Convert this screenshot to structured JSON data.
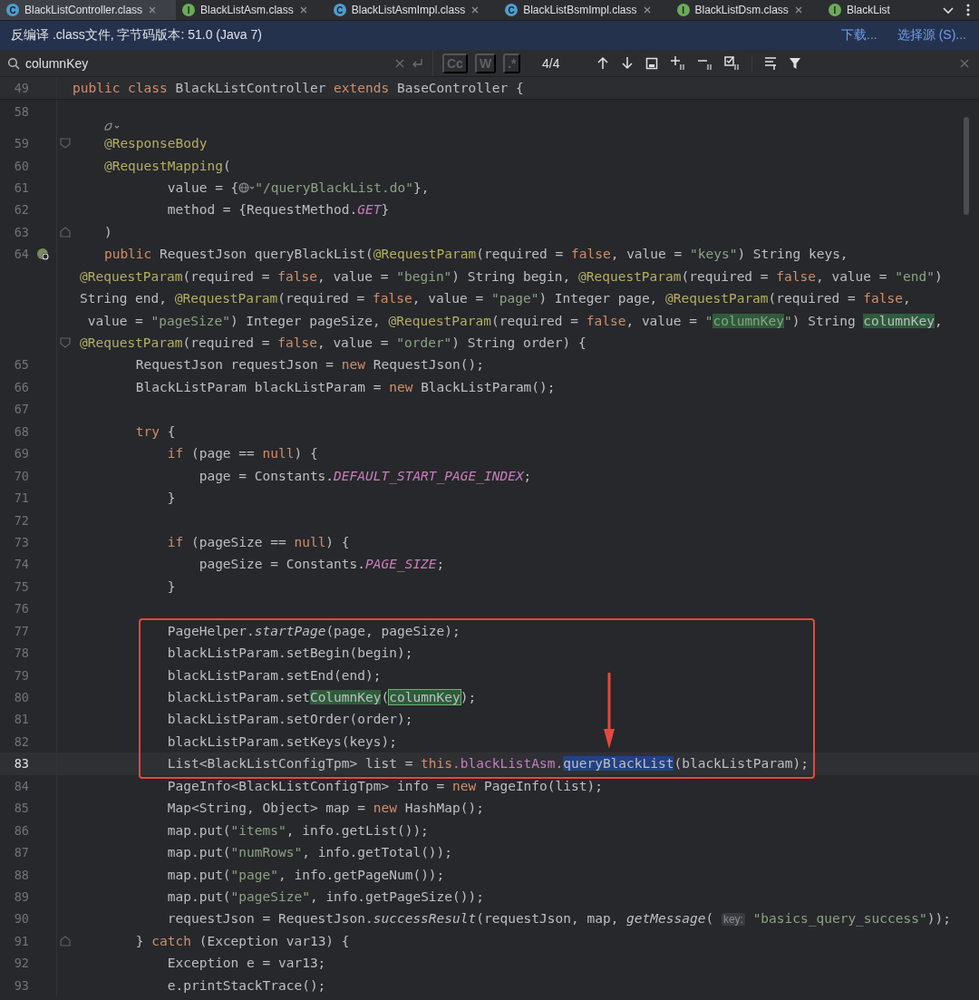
{
  "tabs": [
    {
      "label": "BlackListController.class",
      "icon_letter": "C",
      "color": "#4e9ecf",
      "selected": true
    },
    {
      "label": "BlackListAsm.class",
      "icon_letter": "I",
      "color": "#6bab58",
      "selected": false
    },
    {
      "label": "BlackListAsmImpl.class",
      "icon_letter": "C",
      "color": "#4e9ecf",
      "selected": false
    },
    {
      "label": "BlackListBsmImpl.class",
      "icon_letter": "C",
      "color": "#4e9ecf",
      "selected": false
    },
    {
      "label": "BlackListDsm.class",
      "icon_letter": "I",
      "color": "#6bab58",
      "selected": false
    },
    {
      "label": "BlackList",
      "icon_letter": "I",
      "color": "#6bab58",
      "selected": false
    }
  ],
  "info_bar": {
    "message": "反编译 .class文件, 字节码版本: 51.0 (Java 7)",
    "links": [
      "下载...",
      "选择源 (S)..."
    ]
  },
  "search": {
    "value": "columnKey",
    "options": [
      {
        "label": "Cc",
        "selected": false
      },
      {
        "label": "W",
        "selected": false
      },
      {
        "label": ".*",
        "selected": false
      }
    ],
    "match_count": "4/4"
  },
  "editor": {
    "lines": [
      {
        "number": "49",
        "sticky": true,
        "tokens": [
          {
            "text": "public",
            "kind": "keyword"
          },
          {
            "text": " class",
            "kind": "keyword"
          },
          {
            "text": " BlackListController ",
            "kind": "plain"
          },
          {
            "text": "extends",
            "kind": "keyword"
          },
          {
            "text": " BaseController {",
            "kind": "plain"
          }
        ]
      },
      {
        "number": "58"
      },
      {
        "kind": "inlay"
      },
      {
        "number": "59",
        "fold_start": true,
        "tokens": [
          {
            "text": "    @ResponseBody",
            "kind": "annotation"
          }
        ]
      },
      {
        "number": "60",
        "tokens": [
          {
            "text": "    @RequestMapping",
            "kind": "annotation"
          },
          {
            "text": "(",
            "kind": "plain"
          }
        ]
      },
      {
        "number": "61",
        "tokens": [
          {
            "text": "            value = {",
            "kind": "plain"
          },
          {
            "kind": "globe"
          },
          {
            "text": "\"/queryBlackList.do\"",
            "kind": "string"
          },
          {
            "text": "},",
            "kind": "plain"
          }
        ]
      },
      {
        "number": "62",
        "tokens": [
          {
            "text": "            method = {RequestMethod.",
            "kind": "plain"
          },
          {
            "text": "GET",
            "kind": "constant"
          },
          {
            "text": "}",
            "kind": "plain"
          }
        ]
      },
      {
        "number": "63",
        "fold_end": true,
        "tokens": [
          {
            "text": "    )",
            "kind": "plain"
          }
        ]
      },
      {
        "number": "64",
        "endpoint": true,
        "tokens": [
          {
            "text": "    public",
            "kind": "keyword"
          },
          {
            "text": " RequestJson queryBlackList(",
            "kind": "plain"
          },
          {
            "text": "@RequestParam",
            "kind": "annotation"
          },
          {
            "text": "(required = ",
            "kind": "plain"
          },
          {
            "text": "false",
            "kind": "keyword"
          },
          {
            "text": ", value = ",
            "kind": "plain"
          },
          {
            "text": "\"keys\"",
            "kind": "string"
          },
          {
            "text": ") String keys,",
            "kind": "plain"
          }
        ]
      },
      {
        "wrapped": true,
        "tokens": [
          {
            "text": "@RequestParam",
            "kind": "annotation"
          },
          {
            "text": "(required = ",
            "kind": "plain"
          },
          {
            "text": "false",
            "kind": "keyword"
          },
          {
            "text": ", value = ",
            "kind": "plain"
          },
          {
            "text": "\"begin\"",
            "kind": "string"
          },
          {
            "text": ") String begin, ",
            "kind": "plain"
          },
          {
            "text": "@RequestParam",
            "kind": "annotation"
          },
          {
            "text": "(required = ",
            "kind": "plain"
          },
          {
            "text": "false",
            "kind": "keyword"
          },
          {
            "text": ", value = ",
            "kind": "plain"
          },
          {
            "text": "\"end\"",
            "kind": "string"
          },
          {
            "text": ")",
            "kind": "plain"
          }
        ]
      },
      {
        "wrapped": true,
        "tokens": [
          {
            "text": "String end, ",
            "kind": "plain"
          },
          {
            "text": "@RequestParam",
            "kind": "annotation"
          },
          {
            "text": "(required = ",
            "kind": "plain"
          },
          {
            "text": "false",
            "kind": "keyword"
          },
          {
            "text": ", value = ",
            "kind": "plain"
          },
          {
            "text": "\"page\"",
            "kind": "string"
          },
          {
            "text": ") Integer page, ",
            "kind": "plain"
          },
          {
            "text": "@RequestParam",
            "kind": "annotation"
          },
          {
            "text": "(required = ",
            "kind": "plain"
          },
          {
            "text": "false",
            "kind": "keyword"
          },
          {
            "text": ",",
            "kind": "plain"
          }
        ]
      },
      {
        "wrapped": true,
        "tokens": [
          {
            "text": " value = ",
            "kind": "plain"
          },
          {
            "text": "\"pageSize\"",
            "kind": "string"
          },
          {
            "text": ") Integer pageSize, ",
            "kind": "plain"
          },
          {
            "text": "@RequestParam",
            "kind": "annotation"
          },
          {
            "text": "(required = ",
            "kind": "plain"
          },
          {
            "text": "false",
            "kind": "keyword"
          },
          {
            "text": ", value = ",
            "kind": "plain"
          },
          {
            "text": "\"",
            "kind": "string"
          },
          {
            "text": "columnKey",
            "kind": "string-match"
          },
          {
            "text": "\"",
            "kind": "string"
          },
          {
            "text": ") String ",
            "kind": "plain"
          },
          {
            "text": "columnKey",
            "kind": "match"
          },
          {
            "text": ",",
            "kind": "plain"
          }
        ]
      },
      {
        "wrapped": true,
        "fold_start": true,
        "tokens": [
          {
            "text": "@RequestParam",
            "kind": "annotation"
          },
          {
            "text": "(required = ",
            "kind": "plain"
          },
          {
            "text": "false",
            "kind": "keyword"
          },
          {
            "text": ", value = ",
            "kind": "plain"
          },
          {
            "text": "\"order\"",
            "kind": "string"
          },
          {
            "text": ") String order) {",
            "kind": "plain"
          }
        ]
      },
      {
        "number": "65",
        "tokens": [
          {
            "text": "        RequestJson requestJson = ",
            "kind": "plain"
          },
          {
            "text": "new",
            "kind": "keyword"
          },
          {
            "text": " RequestJson();",
            "kind": "plain"
          }
        ]
      },
      {
        "number": "66",
        "tokens": [
          {
            "text": "        BlackListParam blackListParam = ",
            "kind": "plain"
          },
          {
            "text": "new",
            "kind": "keyword"
          },
          {
            "text": " BlackListParam();",
            "kind": "plain"
          }
        ]
      },
      {
        "number": "67"
      },
      {
        "number": "68",
        "tokens": [
          {
            "text": "        try",
            "kind": "keyword"
          },
          {
            "text": " {",
            "kind": "plain"
          }
        ]
      },
      {
        "number": "69",
        "tokens": [
          {
            "text": "            if",
            "kind": "keyword"
          },
          {
            "text": " (page == ",
            "kind": "plain"
          },
          {
            "text": "null",
            "kind": "keyword"
          },
          {
            "text": ") {",
            "kind": "plain"
          }
        ]
      },
      {
        "number": "70",
        "tokens": [
          {
            "text": "                page = Constants.",
            "kind": "plain"
          },
          {
            "text": "DEFAULT_START_PAGE_INDEX",
            "kind": "constant"
          },
          {
            "text": ";",
            "kind": "plain"
          }
        ]
      },
      {
        "number": "71",
        "tokens": [
          {
            "text": "            }",
            "kind": "plain"
          }
        ]
      },
      {
        "number": "72"
      },
      {
        "number": "73",
        "tokens": [
          {
            "text": "            if",
            "kind": "keyword"
          },
          {
            "text": " (pageSize == ",
            "kind": "plain"
          },
          {
            "text": "null",
            "kind": "keyword"
          },
          {
            "text": ") {",
            "kind": "plain"
          }
        ]
      },
      {
        "number": "74",
        "tokens": [
          {
            "text": "                pageSize = Constants.",
            "kind": "plain"
          },
          {
            "text": "PAGE_SIZE",
            "kind": "constant"
          },
          {
            "text": ";",
            "kind": "plain"
          }
        ]
      },
      {
        "number": "75",
        "tokens": [
          {
            "text": "            }",
            "kind": "plain"
          }
        ]
      },
      {
        "number": "76"
      },
      {
        "number": "77",
        "tokens": [
          {
            "text": "            PageHelper.",
            "kind": "plain"
          },
          {
            "text": "startPage",
            "kind": "italic"
          },
          {
            "text": "(page, pageSize);",
            "kind": "plain"
          }
        ]
      },
      {
        "number": "78",
        "tokens": [
          {
            "text": "            blackListParam.setBegin(begin);",
            "kind": "plain"
          }
        ]
      },
      {
        "number": "79",
        "tokens": [
          {
            "text": "            blackListParam.setEnd(end);",
            "kind": "plain"
          }
        ]
      },
      {
        "number": "80",
        "tokens": [
          {
            "text": "            blackListParam.set",
            "kind": "plain"
          },
          {
            "text": "ColumnKey",
            "kind": "match"
          },
          {
            "text": "(",
            "kind": "plain"
          },
          {
            "text": "columnKey",
            "kind": "current-match"
          },
          {
            "text": ");",
            "kind": "plain"
          }
        ]
      },
      {
        "number": "81",
        "tokens": [
          {
            "text": "            blackListParam.setOrder(order);",
            "kind": "plain"
          }
        ]
      },
      {
        "number": "82",
        "tokens": [
          {
            "text": "            blackListParam.setKeys(keys);",
            "kind": "plain"
          }
        ]
      },
      {
        "number": "83",
        "current": true,
        "tokens": [
          {
            "text": "            List<BlackListConfigTpm> list = ",
            "kind": "plain"
          },
          {
            "text": "this",
            "kind": "keyword"
          },
          {
            "text": ".blackListAsm.",
            "kind": "field"
          },
          {
            "text": "queryBlackList",
            "kind": "selection"
          },
          {
            "text": "(blackListParam);",
            "kind": "plain"
          }
        ]
      },
      {
        "number": "84",
        "tokens": [
          {
            "text": "            PageInfo<BlackListConfigTpm> info = ",
            "kind": "plain"
          },
          {
            "text": "new",
            "kind": "keyword"
          },
          {
            "text": " PageInfo(list);",
            "kind": "plain"
          }
        ]
      },
      {
        "number": "85",
        "tokens": [
          {
            "text": "            Map<String, Object> map = ",
            "kind": "plain"
          },
          {
            "text": "new",
            "kind": "keyword"
          },
          {
            "text": " HashMap();",
            "kind": "plain"
          }
        ]
      },
      {
        "number": "86",
        "tokens": [
          {
            "text": "            map.put(",
            "kind": "plain"
          },
          {
            "text": "\"items\"",
            "kind": "string"
          },
          {
            "text": ", info.getList());",
            "kind": "plain"
          }
        ]
      },
      {
        "number": "87",
        "tokens": [
          {
            "text": "            map.put(",
            "kind": "plain"
          },
          {
            "text": "\"numRows\"",
            "kind": "string"
          },
          {
            "text": ", info.getTotal());",
            "kind": "plain"
          }
        ]
      },
      {
        "number": "88",
        "tokens": [
          {
            "text": "            map.put(",
            "kind": "plain"
          },
          {
            "text": "\"page\"",
            "kind": "string"
          },
          {
            "text": ", info.getPageNum());",
            "kind": "plain"
          }
        ]
      },
      {
        "number": "89",
        "tokens": [
          {
            "text": "            map.put(",
            "kind": "plain"
          },
          {
            "text": "\"pageSize\"",
            "kind": "string"
          },
          {
            "text": ", info.getPageSize());",
            "kind": "plain"
          }
        ]
      },
      {
        "number": "90",
        "tokens": [
          {
            "text": "            requestJson = RequestJson.",
            "kind": "plain"
          },
          {
            "text": "successResult",
            "kind": "italic"
          },
          {
            "text": "(requestJson, map, ",
            "kind": "plain"
          },
          {
            "text": "getMessage",
            "kind": "italic"
          },
          {
            "text": "( ",
            "kind": "plain"
          },
          {
            "text": "key:",
            "kind": "hint"
          },
          {
            "text": " \"basics_query_success\"",
            "kind": "string"
          },
          {
            "text": "));",
            "kind": "plain"
          }
        ]
      },
      {
        "number": "91",
        "fold_end": true,
        "tokens": [
          {
            "text": "        } ",
            "kind": "plain"
          },
          {
            "text": "catch",
            "kind": "keyword"
          },
          {
            "text": " (Exception var13) {",
            "kind": "plain"
          }
        ]
      },
      {
        "number": "92",
        "tokens": [
          {
            "text": "            Exception e = var13;",
            "kind": "plain"
          }
        ]
      },
      {
        "number": "93",
        "tokens": [
          {
            "text": "            e.printStackTrace();",
            "kind": "plain"
          }
        ]
      }
    ]
  }
}
